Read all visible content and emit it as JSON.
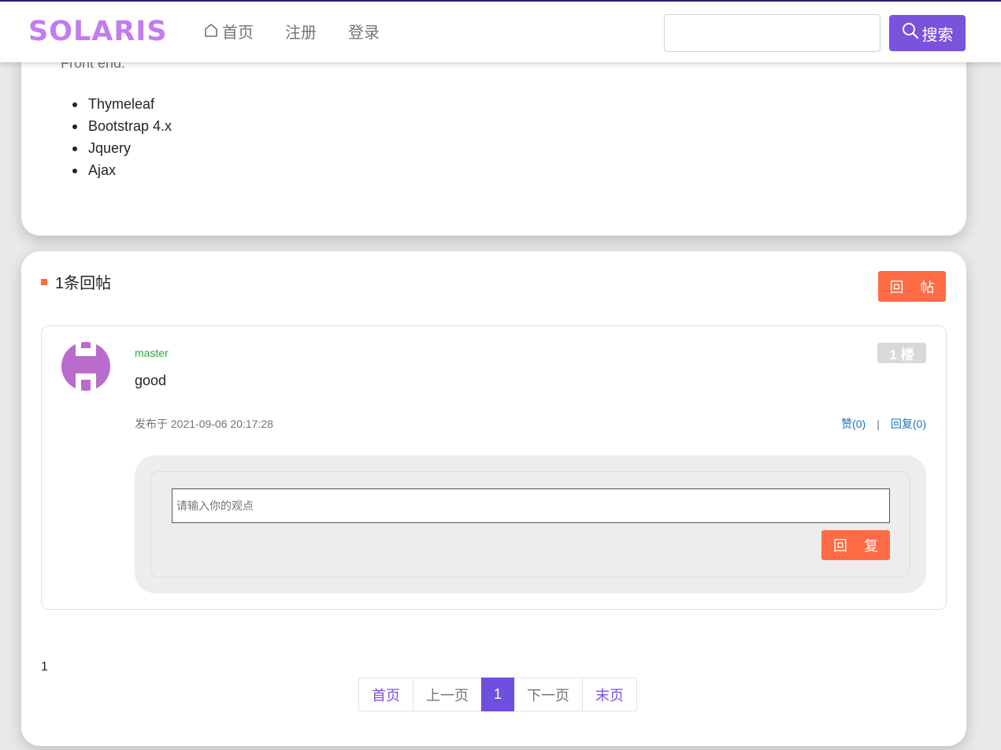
{
  "brand": {
    "logo_text": "SOLARIS",
    "accent_color": "#7a52dc",
    "logo_color": "#c47bf0"
  },
  "nav": {
    "items": [
      {
        "label": "首页",
        "icon": "home-icon"
      },
      {
        "label": "注册"
      },
      {
        "label": "登录"
      }
    ],
    "search": {
      "value": "",
      "button_label": "搜索",
      "icon": "search-icon"
    }
  },
  "article": {
    "frontend_label": "Front end:",
    "tech_list": [
      "Thymeleaf",
      "Bootstrap 4.x",
      "Jquery",
      "Ajax"
    ]
  },
  "replies": {
    "count_label": "1条回帖",
    "post_button_label": "回 帖",
    "comments": [
      {
        "username": "master",
        "floor": "1 楼",
        "text": "good",
        "time": "发布于 2021-09-06 20:17:28",
        "like_label": "赞(0)",
        "separator": "|",
        "reply_label": "回复(0)",
        "reply_placeholder": "请输入你的观点",
        "reply_button_label": "回 复"
      }
    ]
  },
  "pagination": {
    "total_label": "1",
    "first": "首页",
    "prev": "上一页",
    "current": "1",
    "next": "下一页",
    "last": "末页"
  },
  "colors": {
    "post_button": "#ff6b45",
    "username": "#28a745",
    "link": "#1a73c7"
  }
}
